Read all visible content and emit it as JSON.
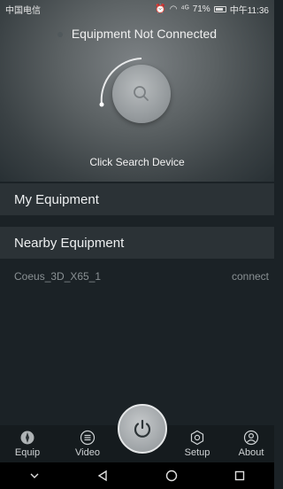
{
  "status_bar": {
    "carrier": "中国电信",
    "signal_text": "⁴ᴳ",
    "battery_text": "71%",
    "time": "中午11:36"
  },
  "hero": {
    "connection_status": "Equipment Not Connected",
    "search_hint": "Click Search Device"
  },
  "sections": {
    "my_equipment": "My Equipment",
    "nearby_equipment": "Nearby Equipment"
  },
  "nearby_devices": [
    {
      "name": "Coeus_3D_X65_1",
      "action": "connect"
    }
  ],
  "tabs": {
    "equip": "Equip",
    "video": "Video",
    "setup": "Setup",
    "about": "About"
  },
  "colors": {
    "background": "#1b2226",
    "section": "#2b3236",
    "muted_text": "#8a9194"
  }
}
